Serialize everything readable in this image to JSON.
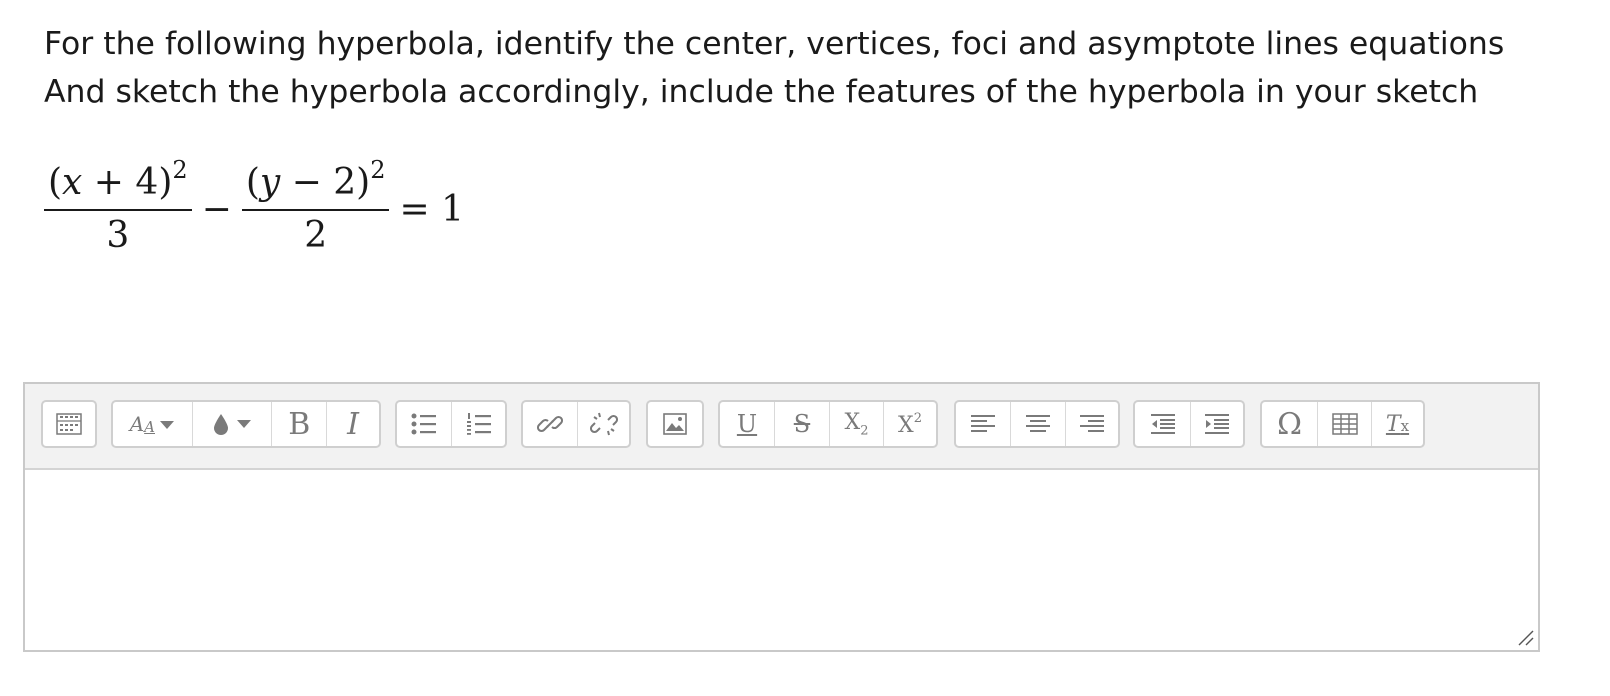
{
  "question": {
    "line1": "For the following hyperbola, identify the center, vertices, foci and asymptote lines equations",
    "line2": "And sketch the hyperbola accordingly, include the features of the hyperbola in your sketch"
  },
  "equation": {
    "term1_open": "(",
    "term1_var": "x",
    "term1_rest": " + 4)",
    "term1_exp": "2",
    "term1_den": "3",
    "minus": "−",
    "term2_open": "(",
    "term2_var": "y",
    "term2_rest": " − 2)",
    "term2_exp": "2",
    "term2_den": "2",
    "equals": "= 1"
  },
  "toolbar": {
    "bold": "B",
    "italic": "I",
    "underline": "U",
    "strike": "S",
    "subscript_base": "X",
    "subscript_sub": "2",
    "superscript_base": "X",
    "superscript_sup": "2",
    "omega": "Ω",
    "clear_T": "T",
    "clear_x": "x",
    "font_A_big": "A",
    "font_A_small": "A",
    "icons": [
      "toolbar-toggle-icon",
      "font-size-icon",
      "font-color-icon",
      "bold-icon",
      "italic-icon",
      "bullet-list-icon",
      "numbered-list-icon",
      "link-icon",
      "unlink-icon",
      "image-icon",
      "underline-icon",
      "strikethrough-icon",
      "subscript-icon",
      "superscript-icon",
      "align-left-icon",
      "align-center-icon",
      "align-right-icon",
      "outdent-icon",
      "indent-icon",
      "special-character-icon",
      "table-icon",
      "clear-formatting-icon"
    ]
  },
  "editor": {
    "content": ""
  },
  "colors": {
    "toolbar_bg": "#f2f2f2",
    "icon": "#7a7a7a",
    "border": "#c9c9c9",
    "text": "#1a1a1a"
  }
}
